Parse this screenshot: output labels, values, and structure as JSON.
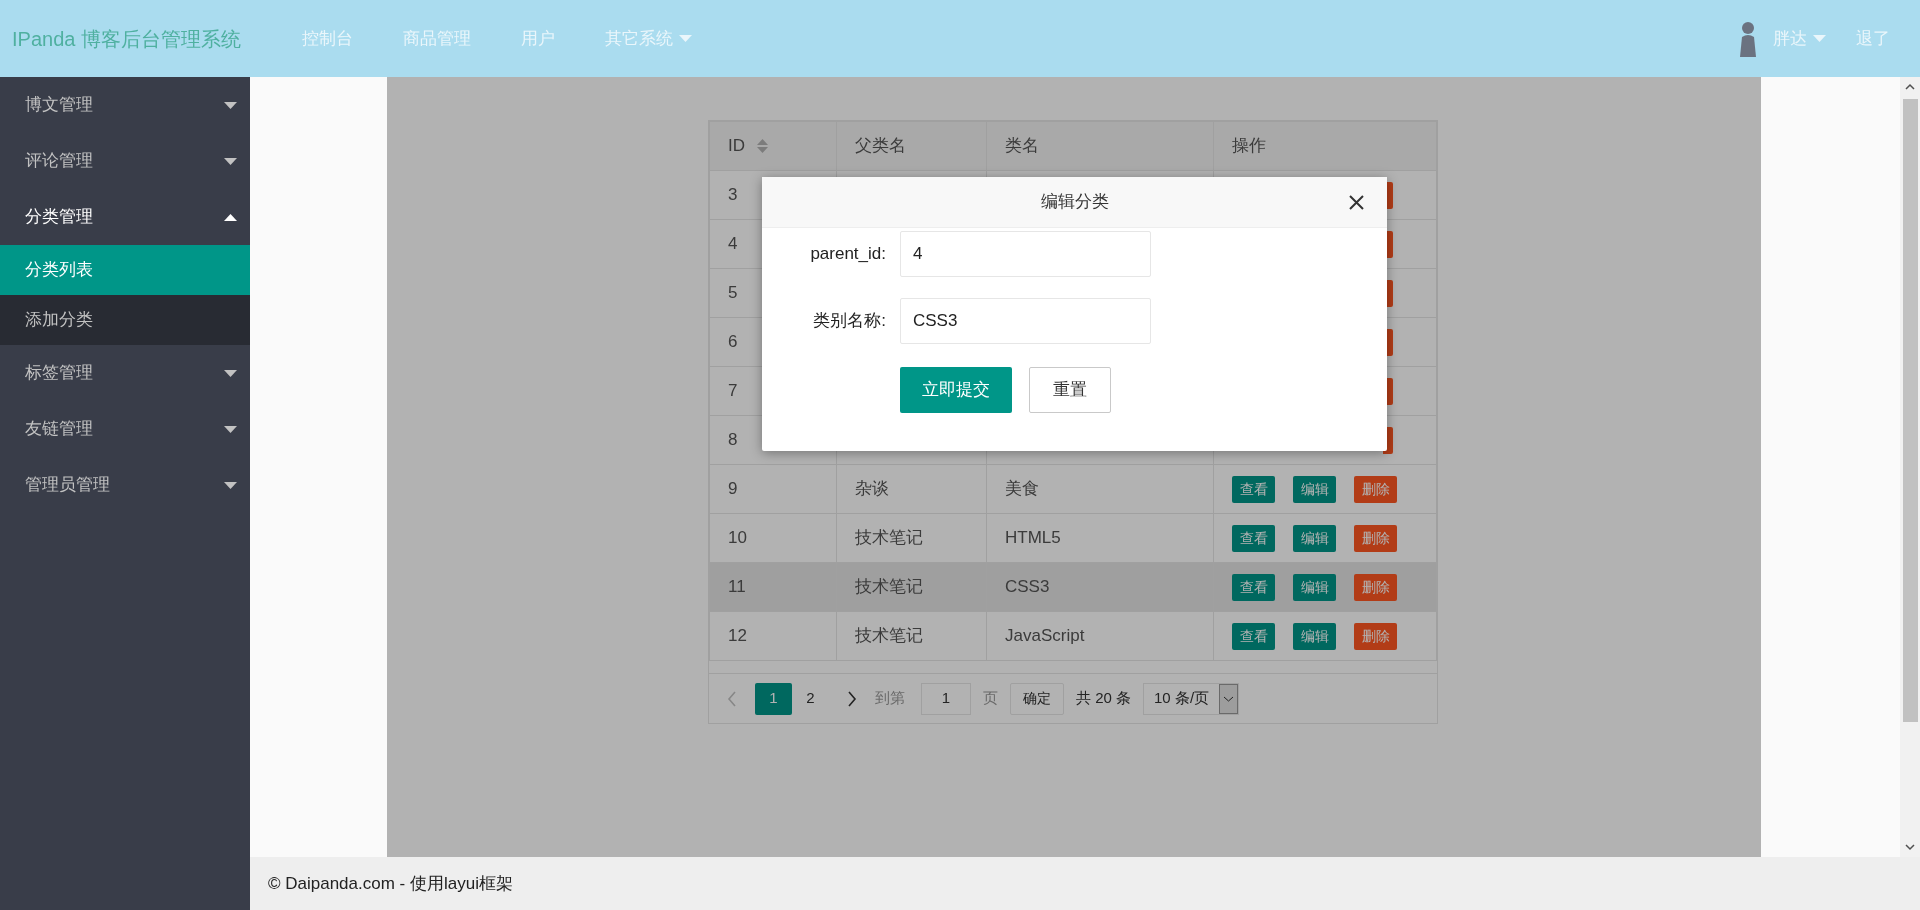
{
  "header": {
    "logo": "IPanda 博客后台管理系统",
    "nav": [
      {
        "label": "控制台",
        "dropdown": false
      },
      {
        "label": "商品管理",
        "dropdown": false
      },
      {
        "label": "用户",
        "dropdown": false
      },
      {
        "label": "其它系统",
        "dropdown": true
      }
    ],
    "user": {
      "name": "胖达",
      "dropdown": true
    },
    "logout": "退了"
  },
  "sidebar": {
    "items": [
      {
        "label": "博文管理",
        "expanded": false
      },
      {
        "label": "评论管理",
        "expanded": false
      },
      {
        "label": "分类管理",
        "expanded": true,
        "children": [
          {
            "label": "分类列表",
            "selected": true
          },
          {
            "label": "添加分类",
            "selected": false
          }
        ]
      },
      {
        "label": "标签管理",
        "expanded": false
      },
      {
        "label": "友链管理",
        "expanded": false
      },
      {
        "label": "管理员管理",
        "expanded": false
      }
    ]
  },
  "table": {
    "columns": [
      {
        "label": "ID",
        "sortable": true
      },
      {
        "label": "父类名",
        "sortable": false
      },
      {
        "label": "类名",
        "sortable": false
      },
      {
        "label": "操作",
        "sortable": false
      }
    ],
    "rows": [
      {
        "kind": "covered",
        "id": "3",
        "highlighted": false
      },
      {
        "kind": "covered",
        "id": "4",
        "highlighted": false
      },
      {
        "kind": "covered",
        "id": "5",
        "highlighted": false
      },
      {
        "kind": "covered",
        "id": "6",
        "highlighted": false
      },
      {
        "kind": "covered",
        "id": "7",
        "highlighted": false
      },
      {
        "kind": "covered",
        "id": "8",
        "highlighted": false
      },
      {
        "kind": "full",
        "id": "9",
        "parent": "杂谈",
        "name": "美食",
        "highlighted": false,
        "actions": [
          {
            "label": "查看",
            "kind": "normal"
          },
          {
            "label": "编辑",
            "kind": "normal"
          },
          {
            "label": "删除",
            "kind": "danger"
          }
        ]
      },
      {
        "kind": "full",
        "id": "10",
        "parent": "技术笔记",
        "name": "HTML5",
        "highlighted": false,
        "actions": [
          {
            "label": "查看",
            "kind": "normal"
          },
          {
            "label": "编辑",
            "kind": "normal"
          },
          {
            "label": "删除",
            "kind": "danger"
          }
        ]
      },
      {
        "kind": "full",
        "id": "11",
        "parent": "技术笔记",
        "name": "CSS3",
        "highlighted": true,
        "actions": [
          {
            "label": "查看",
            "kind": "normal"
          },
          {
            "label": "编辑",
            "kind": "normal"
          },
          {
            "label": "删除",
            "kind": "danger"
          }
        ]
      },
      {
        "kind": "full",
        "id": "12",
        "parent": "技术笔记",
        "name": "JavaScript",
        "highlighted": false,
        "actions": [
          {
            "label": "查看",
            "kind": "normal"
          },
          {
            "label": "编辑",
            "kind": "normal"
          },
          {
            "label": "删除",
            "kind": "danger"
          }
        ]
      }
    ]
  },
  "pagination": {
    "pages": [
      {
        "label": "1",
        "selected": true
      },
      {
        "label": "2",
        "selected": false
      }
    ],
    "goto_label": "到第",
    "page_input": "1",
    "page_unit": "页",
    "confirm": "确定",
    "total": "共 20 条",
    "page_size": "10 条/页"
  },
  "dialog": {
    "title": "编辑分类",
    "fields": [
      {
        "label": "parent_id:",
        "value": "4"
      },
      {
        "label": "类别名称:",
        "value": "CSS3"
      }
    ],
    "buttons": [
      {
        "label": "立即提交",
        "kind": "primary"
      },
      {
        "label": "重置",
        "kind": "default"
      }
    ]
  },
  "footer": "© Daipanda.com - 使用layui框架"
}
